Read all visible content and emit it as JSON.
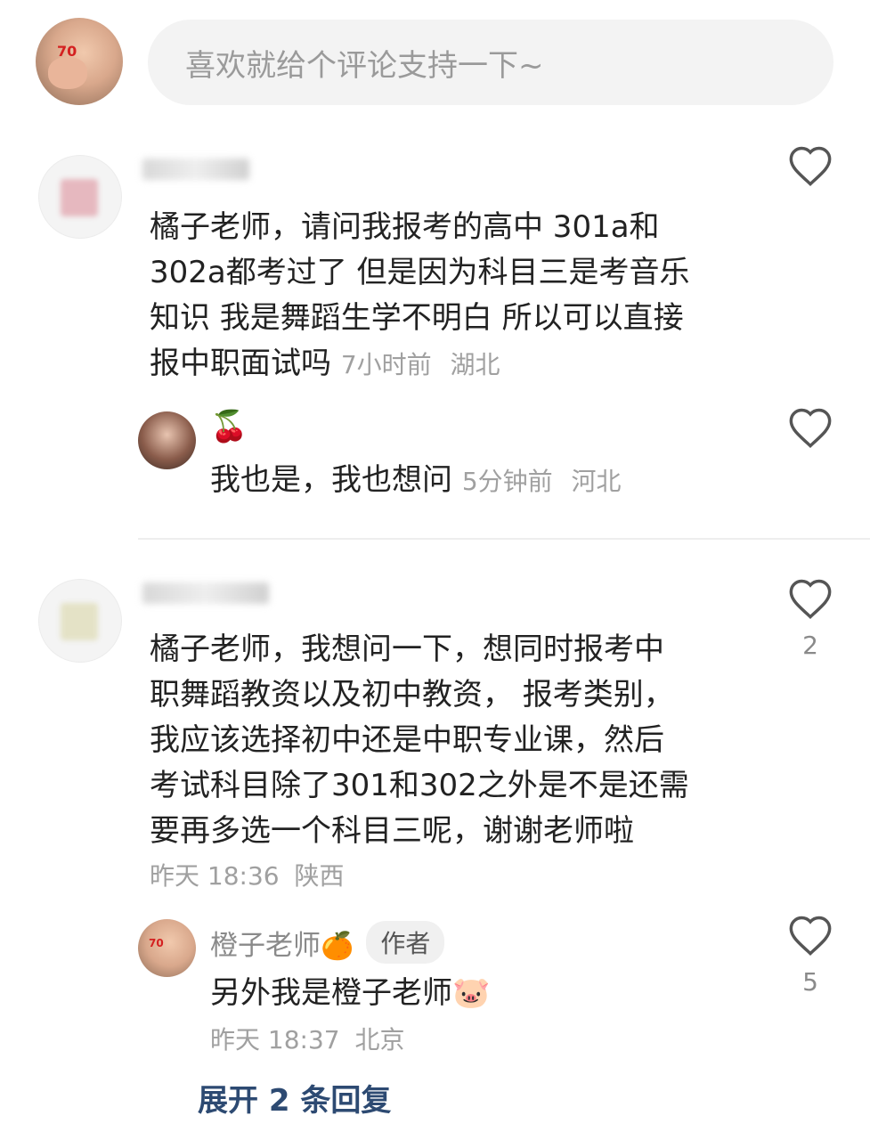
{
  "input": {
    "placeholder": "喜欢就给个评论支持一下~"
  },
  "my_avatar": {
    "badge": "70"
  },
  "comments": [
    {
      "text_lines": [
        "橘子老师，请问我报考的高中 301a和",
        "302a都考过了 但是因为科目三是考音乐",
        "知识 我是舞蹈生学不明白 所以可以直接",
        "报中职面试吗"
      ],
      "time": "7小时前",
      "location": "湖北",
      "replies": [
        {
          "badge": "🍒",
          "text": "我也是，我也想问",
          "time": "5分钟前",
          "location": "河北"
        }
      ]
    },
    {
      "like_count": "2",
      "text_lines": [
        "橘子老师，我想问一下，想同时报考中",
        "职舞蹈教资以及初中教资， 报考类别，",
        "我应该选择初中还是中职专业课，然后",
        "考试科目除了301和302之外是不是还需",
        "要再多选一个科目三呢，谢谢老师啦"
      ],
      "time": "昨天 18:36",
      "location": "陕西",
      "replies": [
        {
          "name": "橙子老师",
          "name_emoji": "🍊",
          "author_tag": "作者",
          "text": "另外我是橙子老师",
          "sticker": "🐷",
          "time": "昨天 18:37",
          "location": "北京",
          "like_count": "5",
          "badge": "70"
        }
      ],
      "expand": "展开 2 条回复"
    }
  ],
  "colors": {
    "accent_link": "#2d4a72",
    "meta": "#a0a0a0",
    "input_bg": "#f3f3f3"
  },
  "icons": {
    "like": "heart-outline-icon"
  }
}
